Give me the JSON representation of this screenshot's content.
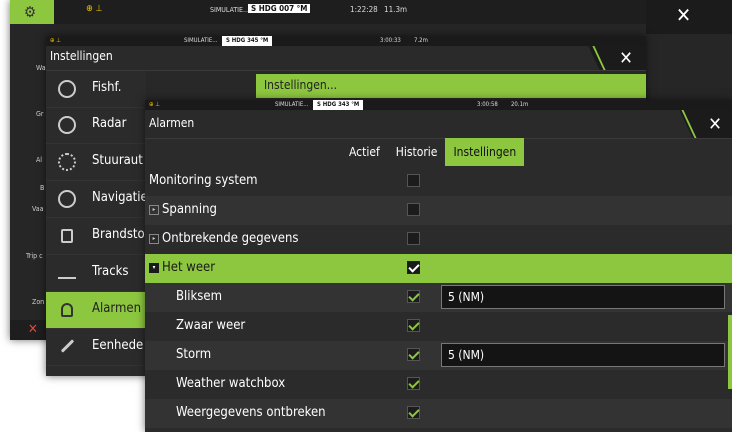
{
  "back_window": {
    "status": {
      "label": "SIMULATIE...",
      "heading": "S HDG 007 °M",
      "time": "1:22:28",
      "dist": "11.3m"
    }
  },
  "mid_window": {
    "status": {
      "label": "SIMULATIE...",
      "heading": "S HDG 345 °M",
      "time": "3:00:33",
      "dist": "7.2m"
    },
    "title": "Instellingen",
    "right_header": "Instellingen...",
    "left_fragments": [
      "Wa",
      "Gr",
      "Al",
      "B",
      "Vaa",
      "Trip c",
      "Zon"
    ],
    "menu": [
      {
        "label": "Fishf.",
        "icon": "fish-finder-icon"
      },
      {
        "label": "Radar",
        "icon": "radar-icon"
      },
      {
        "label": "Stuuraut",
        "icon": "steering-wheel-icon"
      },
      {
        "label": "Navigatie",
        "icon": "compass-icon"
      },
      {
        "label": "Brandsto",
        "icon": "fuel-pump-icon"
      },
      {
        "label": "Tracks",
        "icon": "tracks-icon"
      },
      {
        "label": "Alarmen",
        "icon": "bell-icon"
      },
      {
        "label": "Eenhede",
        "icon": "pencil-icon"
      }
    ]
  },
  "front_window": {
    "status": {
      "label": "SIMULATIE...",
      "heading": "S HDG 343 °M",
      "time": "3:00:58",
      "dist": "20.1m"
    },
    "title": "Alarmen",
    "tabs": [
      {
        "label": "Actief",
        "active": false
      },
      {
        "label": "Historie",
        "active": false
      },
      {
        "label": "Instellingen",
        "active": true
      }
    ],
    "rows": [
      {
        "label": "Monitoring system",
        "level": 0,
        "expander": false,
        "checked": false,
        "value": ""
      },
      {
        "label": "Spanning",
        "level": 0,
        "expander": true,
        "checked": false,
        "value": ""
      },
      {
        "label": "Ontbrekende gegevens",
        "level": 0,
        "expander": true,
        "checked": false,
        "value": ""
      },
      {
        "label": "Het weer",
        "level": 0,
        "expander": true,
        "checked": true,
        "value": "",
        "selected": true
      },
      {
        "label": "Bliksem",
        "level": 1,
        "expander": false,
        "checked": true,
        "value": "5 (NM)"
      },
      {
        "label": "Zwaar weer",
        "level": 1,
        "expander": false,
        "checked": true,
        "value": ""
      },
      {
        "label": "Storm",
        "level": 1,
        "expander": false,
        "checked": true,
        "value": "5 (NM)"
      },
      {
        "label": "Weather watchbox",
        "level": 1,
        "expander": false,
        "checked": true,
        "value": ""
      },
      {
        "label": "Weergegevens ontbreken",
        "level": 1,
        "expander": false,
        "checked": true,
        "value": ""
      }
    ],
    "colors": {
      "accent": "#8dc63f",
      "row_even": "#2b2b2b",
      "row_odd": "#333333"
    }
  }
}
